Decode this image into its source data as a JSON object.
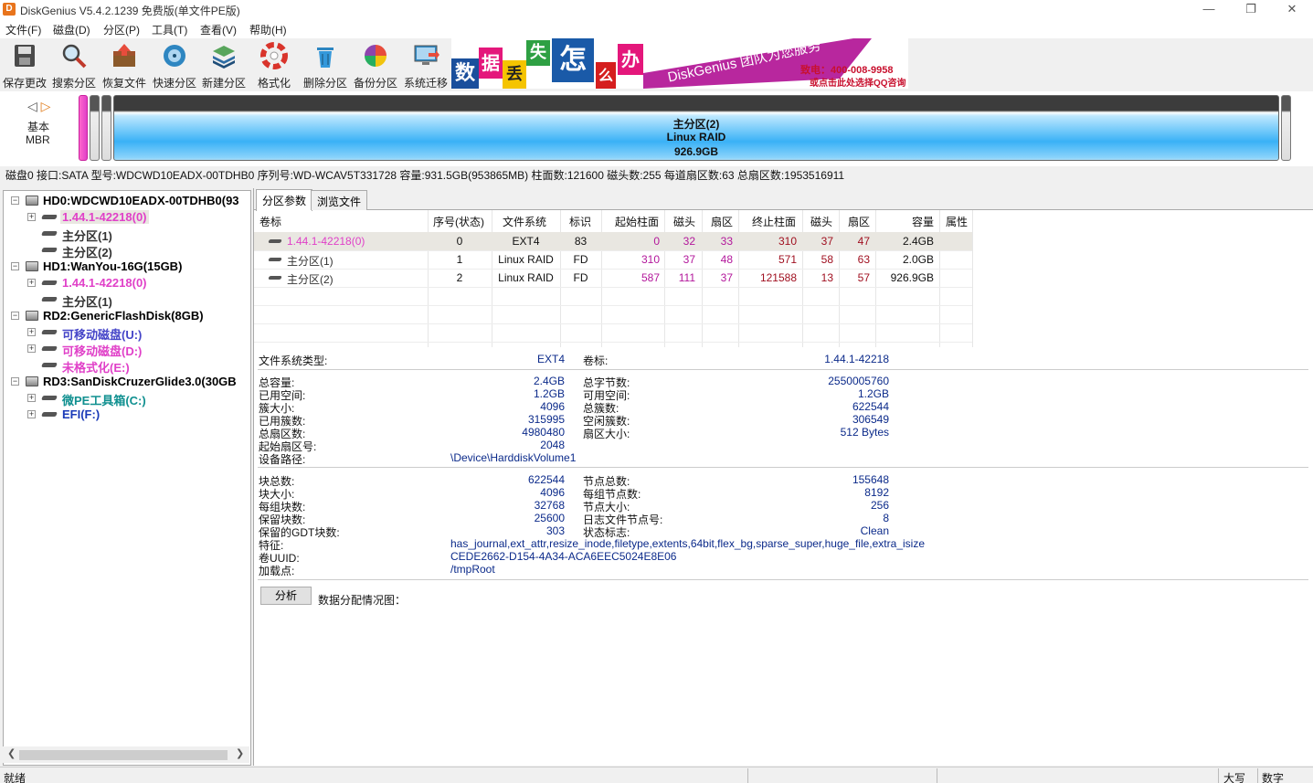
{
  "window": {
    "title": "DiskGenius V5.4.2.1239 免费版(单文件PE版)",
    "icon_letter": "D",
    "minimize_icon": "minimize-icon",
    "restore_icon": "restore-icon",
    "close_icon": "close-icon"
  },
  "menu": [
    "文件(F)",
    "磁盘(D)",
    "分区(P)",
    "工具(T)",
    "查看(V)",
    "帮助(H)"
  ],
  "toolbar": [
    {
      "label": "保存更改",
      "icon": "save-icon"
    },
    {
      "label": "搜索分区",
      "icon": "search-icon"
    },
    {
      "label": "恢复文件",
      "icon": "recover-icon"
    },
    {
      "label": "快速分区",
      "icon": "quick-partition-icon"
    },
    {
      "label": "新建分区",
      "icon": "new-partition-icon"
    },
    {
      "label": "格式化",
      "icon": "format-icon"
    },
    {
      "label": "删除分区",
      "icon": "delete-icon"
    },
    {
      "label": "备份分区",
      "icon": "backup-icon"
    },
    {
      "label": "系统迁移",
      "icon": "migrate-icon"
    }
  ],
  "banner": {
    "chars": [
      "数",
      "据",
      "丢",
      "失",
      "怎",
      "么",
      "办"
    ],
    "slogan": "DiskGenius 团队为您服务",
    "phone": "致电：400-008-9958",
    "qq": "或点击此处选择QQ咨询"
  },
  "diskmap": {
    "basic": "基本",
    "mbr": "MBR",
    "main_partition": {
      "name": "主分区(2)",
      "fs": "Linux RAID",
      "size": "926.9GB"
    }
  },
  "disk_info": "磁盘0 接口:SATA  型号:WDCWD10EADX-00TDHB0  序列号:WD-WCAV5T331728  容量:931.5GB(953865MB)  柱面数:121600  磁头数:255  每道扇区数:63  总扇区数:1953516911",
  "tree": [
    {
      "level": 0,
      "text": "HD0:WDCWD10EADX-00TDHB0(93",
      "type": "disk",
      "color": "#000000",
      "expanded": true
    },
    {
      "level": 1,
      "text": "1.44.1-42218(0)",
      "type": "part",
      "color": "#e040c8",
      "selected": true,
      "expandable": true
    },
    {
      "level": 1,
      "text": "主分区(1)",
      "type": "part",
      "color": "#333333"
    },
    {
      "level": 1,
      "text": "主分区(2)",
      "type": "part",
      "color": "#333333"
    },
    {
      "level": 0,
      "text": "HD1:WanYou-16G(15GB)",
      "type": "disk",
      "color": "#000000",
      "expanded": true
    },
    {
      "level": 1,
      "text": "1.44.1-42218(0)",
      "type": "part",
      "color": "#e040c8",
      "expandable": true
    },
    {
      "level": 1,
      "text": "主分区(1)",
      "type": "part",
      "color": "#333333"
    },
    {
      "level": 0,
      "text": "RD2:GenericFlashDisk(8GB)",
      "type": "disk",
      "color": "#000000",
      "expanded": true
    },
    {
      "level": 1,
      "text": "可移动磁盘(U:)",
      "type": "part",
      "color": "#4545c8",
      "expandable": true
    },
    {
      "level": 1,
      "text": "可移动磁盘(D:)",
      "type": "part",
      "color": "#e040c8",
      "expandable": true
    },
    {
      "level": 1,
      "text": "未格式化(E:)",
      "type": "part",
      "color": "#e040c8"
    },
    {
      "level": 0,
      "text": "RD3:SanDiskCruzerGlide3.0(30GB",
      "type": "disk",
      "color": "#000000",
      "expanded": true
    },
    {
      "level": 1,
      "text": "微PE工具箱(C:)",
      "type": "part",
      "color": "#109090",
      "expandable": true
    },
    {
      "level": 1,
      "text": "EFI(F:)",
      "type": "part",
      "color": "#1a3ab8",
      "expandable": true
    }
  ],
  "tabs": [
    "分区参数",
    "浏览文件"
  ],
  "table": {
    "headers": [
      "卷标",
      "序号(状态)",
      "文件系统",
      "标识",
      "起始柱面",
      "磁头",
      "扇区",
      "终止柱面",
      "磁头",
      "扇区",
      "容量",
      "属性"
    ],
    "rows": [
      {
        "label": "1.44.1-42218(0)",
        "num": "0",
        "fs": "EXT4",
        "id": "83",
        "start_cyl": "0",
        "start_head": "32",
        "start_sec": "33",
        "end_cyl": "310",
        "end_head": "37",
        "end_sec": "47",
        "size": "2.4GB",
        "attr": "",
        "label_color": "#e040c8",
        "selected": true
      },
      {
        "label": "主分区(1)",
        "num": "1",
        "fs": "Linux RAID",
        "id": "FD",
        "start_cyl": "310",
        "start_head": "37",
        "start_sec": "48",
        "end_cyl": "571",
        "end_head": "58",
        "end_sec": "63",
        "size": "2.0GB",
        "attr": "",
        "label_color": "#333333"
      },
      {
        "label": "主分区(2)",
        "num": "2",
        "fs": "Linux RAID",
        "id": "FD",
        "start_cyl": "587",
        "start_head": "111",
        "start_sec": "37",
        "end_cyl": "121588",
        "end_head": "13",
        "end_sec": "57",
        "size": "926.9GB",
        "attr": "",
        "label_color": "#333333"
      }
    ]
  },
  "details": {
    "fs_type_label": "文件系统类型:",
    "fs_type": "EXT4",
    "volume_label_label": "卷标:",
    "volume_label": "1.44.1-42218",
    "group1": [
      {
        "l": "总容量:",
        "v": "2.4GB",
        "l2": "总字节数:",
        "v2": "2550005760"
      },
      {
        "l": "已用空间:",
        "v": "1.2GB",
        "l2": "可用空间:",
        "v2": "1.2GB"
      },
      {
        "l": "簇大小:",
        "v": "4096",
        "l2": "总簇数:",
        "v2": "622544"
      },
      {
        "l": "已用簇数:",
        "v": "315995",
        "l2": "空闲簇数:",
        "v2": "306549"
      },
      {
        "l": "总扇区数:",
        "v": "4980480",
        "l2": "扇区大小:",
        "v2": "512 Bytes"
      },
      {
        "l": "起始扇区号:",
        "v": "2048",
        "l2": "",
        "v2": ""
      }
    ],
    "device_path_label": "设备路径:",
    "device_path": "\\Device\\HarddiskVolume1",
    "group2": [
      {
        "l": "块总数:",
        "v": "622544",
        "l2": "节点总数:",
        "v2": "155648"
      },
      {
        "l": "块大小:",
        "v": "4096",
        "l2": "每组节点数:",
        "v2": "8192"
      },
      {
        "l": "每组块数:",
        "v": "32768",
        "l2": "节点大小:",
        "v2": "256"
      },
      {
        "l": "保留块数:",
        "v": "25600",
        "l2": "日志文件节点号:",
        "v2": "8"
      },
      {
        "l": "保留的GDT块数:",
        "v": "303",
        "l2": "状态标志:",
        "v2": "Clean"
      }
    ],
    "features_label": "特征:",
    "features": "has_journal,ext_attr,resize_inode,filetype,extents,64bit,flex_bg,sparse_super,huge_file,extra_isize",
    "uuid_label": "卷UUID:",
    "uuid": "CEDE2662-D154-4A34-ACA6EEC5024E8E06",
    "mount_label": "加载点:",
    "mount": "/tmpRoot",
    "analyze_button": "分析",
    "data_alloc_label": "数据分配情况图："
  },
  "status": {
    "left": "就绪",
    "caps": "大写",
    "num": "数字"
  }
}
